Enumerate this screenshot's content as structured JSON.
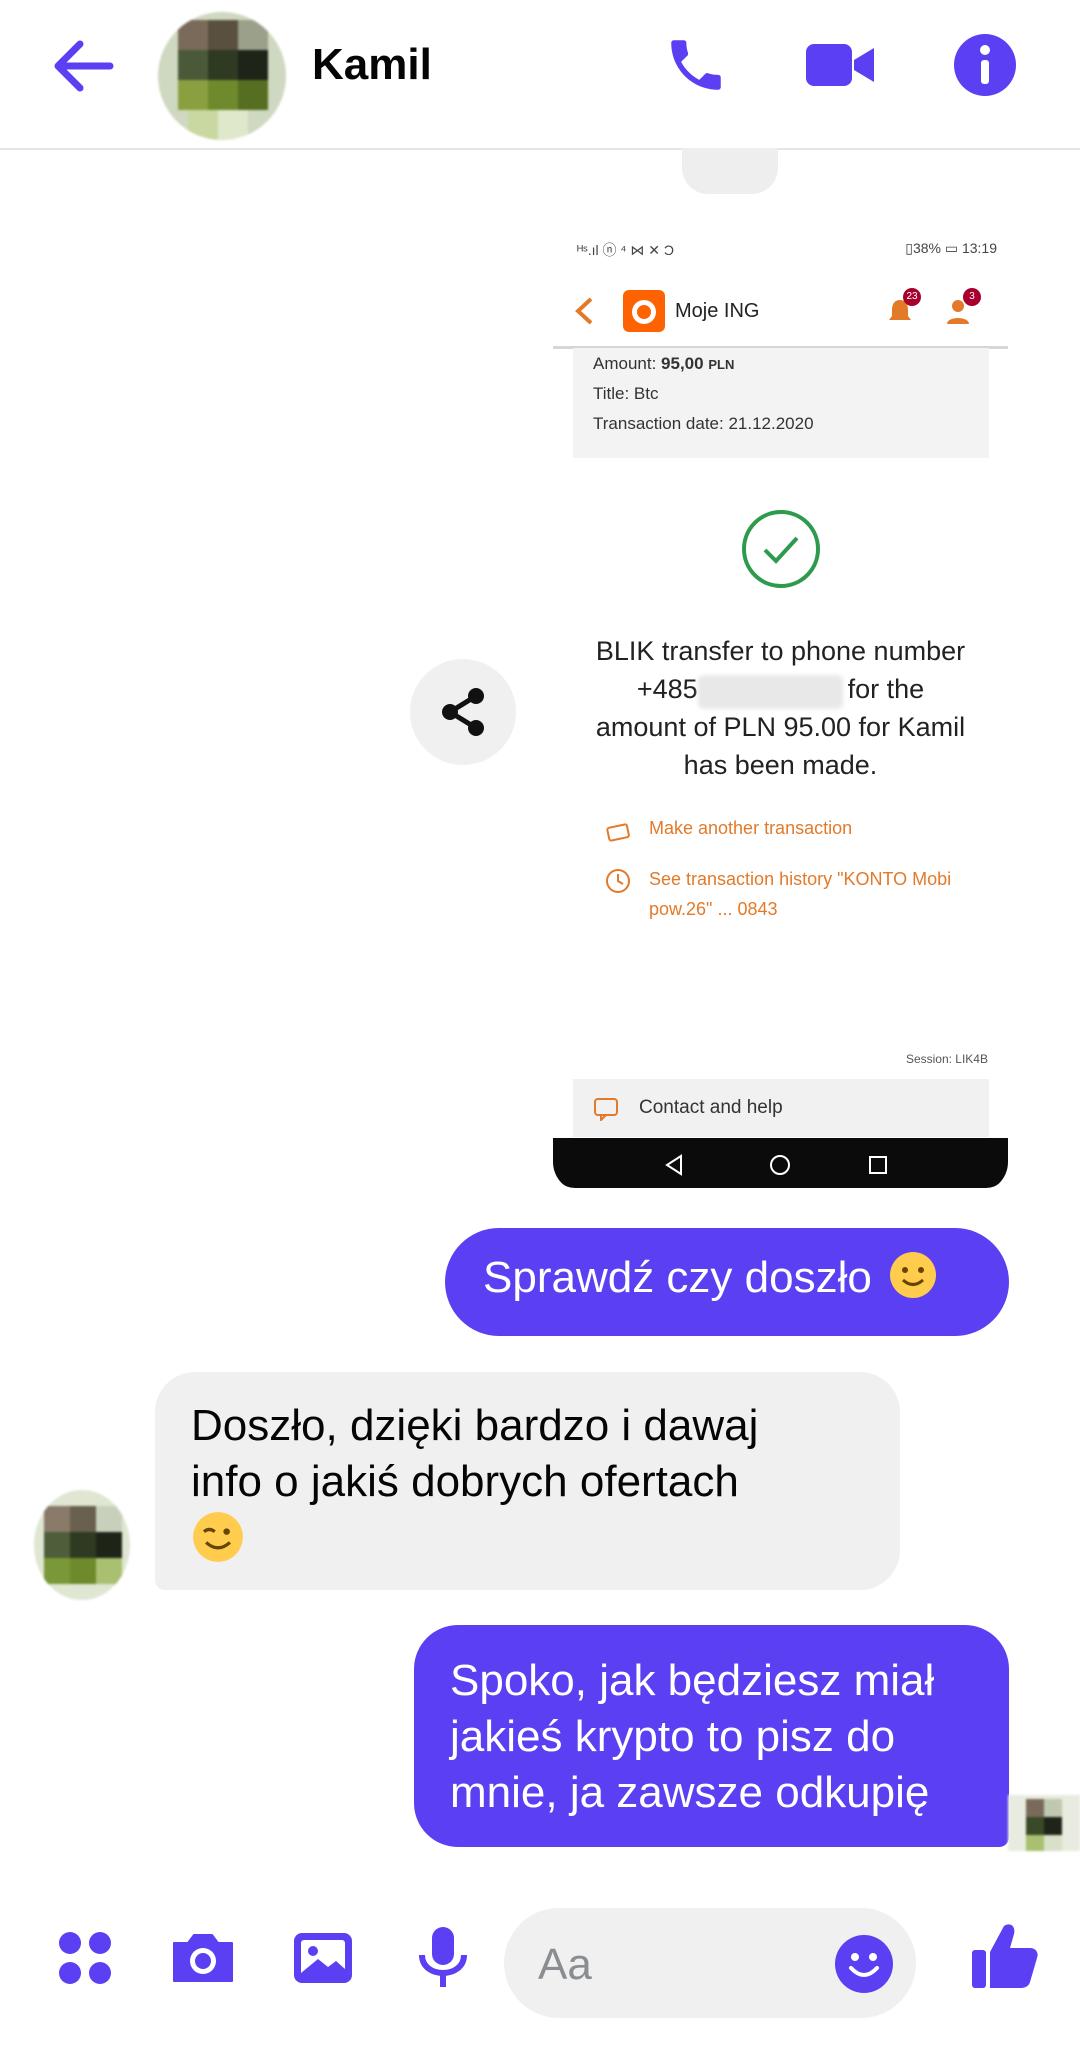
{
  "header": {
    "contact_name": "Kamil",
    "icons": [
      "back-arrow-icon",
      "phone-icon",
      "video-icon",
      "info-icon"
    ],
    "accent_color": "#5b3ff2"
  },
  "shared_screenshot": {
    "status_left": "ᴴˢ.ıl ⓝ ⁴ ⋈ ✕ Ɔ",
    "status_right": "▯38% ▭ 13:19",
    "app_title": "Moje ING",
    "notification_badge_1": "23",
    "notification_badge_2": "3",
    "amount_label": "Amount:",
    "amount_value": "95,00",
    "amount_currency": "PLN",
    "title_line": "Title: Btc",
    "date_line": "Transaction date: 21.12.2020",
    "message_line1": "BLIK transfer to phone number",
    "message_line2": "+485",
    "message_line2_end": "for the",
    "message_line3": "amount of PLN 95.00 for Kamil",
    "message_line4": "has been made.",
    "link_1": "Make another transaction",
    "link_2_line1": "See transaction history \"KONTO Mobi",
    "link_2_line2": "pow.26\" ... 0843",
    "session": "Session: LIK4B",
    "help": "Contact and help"
  },
  "messages": [
    {
      "direction": "outgoing",
      "text": "Sprawdź czy doszło",
      "emoji": "slight-smile"
    },
    {
      "direction": "incoming",
      "text_line1": "Doszło, dzięki bardzo i dawaj",
      "text_line2": "info o jakiś dobrych ofertach",
      "emoji": "wink"
    },
    {
      "direction": "outgoing",
      "text_line1": "Spoko, jak będziesz miał",
      "text_line2": "jakieś krypto to pisz do",
      "text_line3": "mnie, ja zawsze odkupię"
    }
  ],
  "composer": {
    "placeholder": "Aa",
    "icons": [
      "apps-icon",
      "camera-icon",
      "gallery-icon",
      "microphone-icon",
      "emoji-icon",
      "thumbs-up-icon"
    ]
  }
}
